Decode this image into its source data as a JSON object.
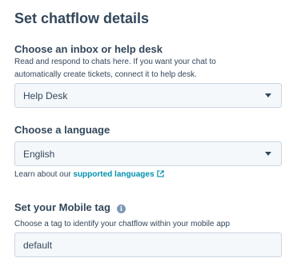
{
  "page": {
    "title": "Set chatflow details"
  },
  "inbox": {
    "label": "Choose an inbox or help desk",
    "help_line1": "Read and respond to chats here. If you want your chat to",
    "help_line2": "automatically create tickets, connect it to help desk.",
    "selected": "Help Desk"
  },
  "language": {
    "label": "Choose a language",
    "selected": "English",
    "help_prefix": "Learn about our ",
    "help_link": "supported languages"
  },
  "mobile_tag": {
    "label": "Set your Mobile tag",
    "help": "Choose a tag to identify your chatflow within your mobile app",
    "value": "default"
  },
  "icons": {
    "caret": "chevron-down-icon",
    "external_link": "external-link-icon",
    "info": "info-icon"
  }
}
